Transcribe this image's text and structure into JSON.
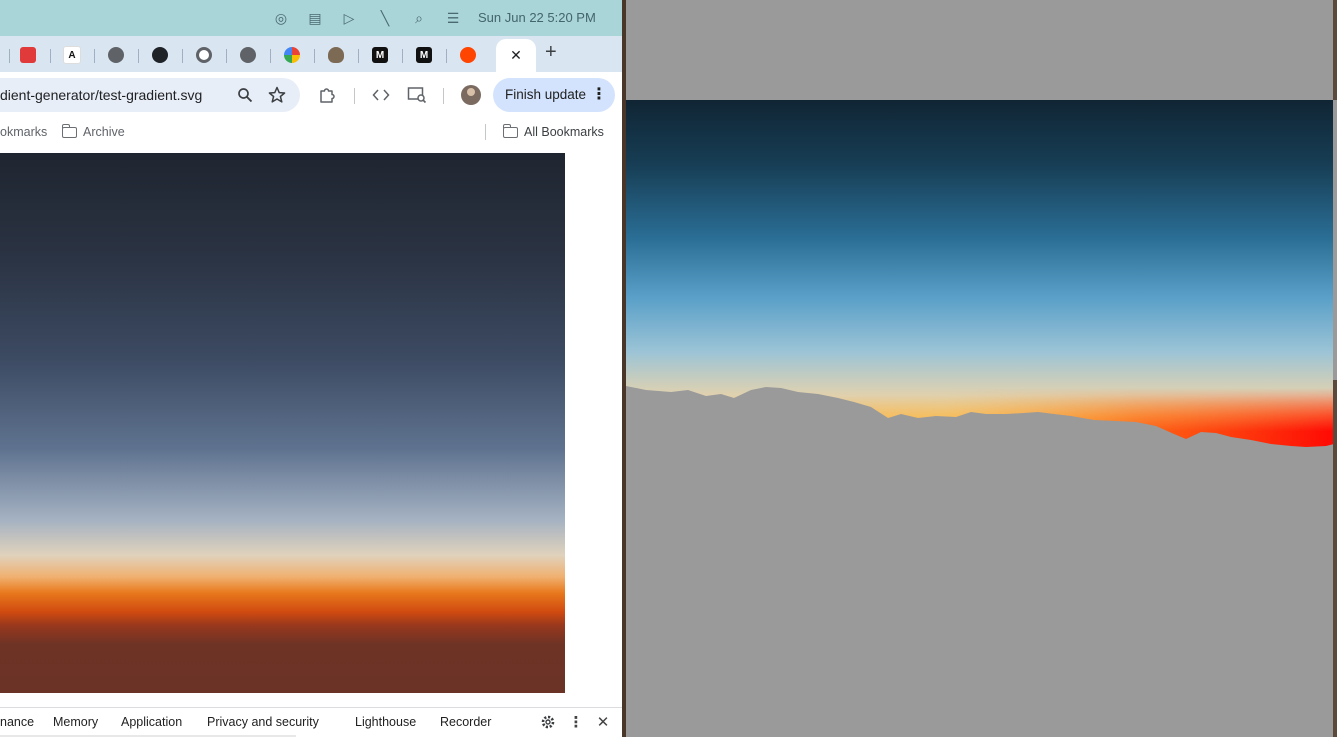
{
  "menubar": {
    "clock": "Sun Jun 22  5:20 PM",
    "icons": [
      "status-icon",
      "menu-app-icon",
      "play-icon",
      "mute-icon",
      "spotlight-search-icon",
      "control-center-icon"
    ]
  },
  "tabs": [
    {
      "name": "tab-red-app",
      "glyph": "■",
      "color": "#e03a3a"
    },
    {
      "name": "tab-font-app",
      "glyph": "A",
      "color": "#1a1a1a"
    },
    {
      "name": "tab-globe",
      "glyph": "◉",
      "color": "#5f6368"
    },
    {
      "name": "tab-github",
      "glyph": "●",
      "color": "#1f2328"
    },
    {
      "name": "tab-chrome",
      "glyph": "◎",
      "color": "#5f6368"
    },
    {
      "name": "tab-globe-2",
      "glyph": "◉",
      "color": "#5f6368"
    },
    {
      "name": "tab-google-photos",
      "glyph": "✿",
      "color": "#f0a030"
    },
    {
      "name": "tab-gimp",
      "glyph": "◕",
      "color": "#6a5a4a"
    },
    {
      "name": "tab-m-app",
      "glyph": "M",
      "color": "#111111"
    },
    {
      "name": "tab-m-app-2",
      "glyph": "M",
      "color": "#111111"
    },
    {
      "name": "tab-reddit",
      "glyph": "●",
      "color": "#ff4500"
    }
  ],
  "active_tab": {
    "close_glyph": "✕"
  },
  "new_tab_glyph": "+",
  "toolbar": {
    "url": "dient-generator/test-gradient.svg",
    "update_label": "Finish update",
    "more_glyph": "⋮"
  },
  "bookmarks": {
    "left_label": "okmarks",
    "archive_label": "Archive",
    "all_label": "All Bookmarks"
  },
  "devtools": {
    "tabs": [
      "nance",
      "Memory",
      "Application",
      "Privacy and security",
      "Lighthouse",
      "Recorder"
    ],
    "close_glyph": "✕",
    "more_glyph": "⋮",
    "settings_glyph": "⚙"
  },
  "colors": {
    "menubar": "#a9d4d8",
    "tabstrip": "#d9e6f2",
    "update_button": "#d3e3fd",
    "preview_background": "#9a9a9a"
  }
}
